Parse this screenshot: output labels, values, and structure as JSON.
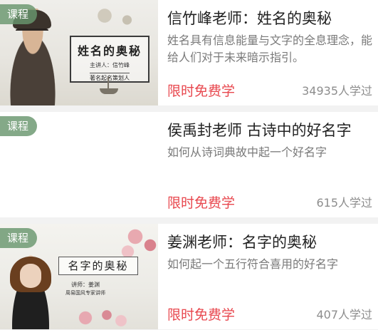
{
  "courses": [
    {
      "tag": "课程",
      "title": "信竹峰老师：姓名的奥秘",
      "description": "姓名具有信息能量与文字的全息理念，能给人们对于未来暗示指引。",
      "promo": "限时免费学",
      "learners": "34935人学过",
      "thumbnail": {
        "board_title": "姓名的奥秘",
        "board_sub": "主讲人：信竹峰",
        "board_sub2": "著名起名策划人"
      }
    },
    {
      "tag": "课程",
      "title": "侯禹封老师 古诗中的好名字",
      "description": "如何从诗词典故中起一个好名字",
      "promo": "限时免费学",
      "learners": "615人学过",
      "thumbnail": {}
    },
    {
      "tag": "课程",
      "title": "姜渊老师：名字的奥秘",
      "description": "如何起一个五行符合喜用的好名字",
      "promo": "限时免费学",
      "learners": "407人学过",
      "thumbnail": {
        "board_title": "名字的奥秘",
        "board_sub": "讲师：姜渊",
        "board_sub2": "周易国风专家讲师"
      }
    }
  ],
  "colors": {
    "promo": "#e8474e",
    "tag_bg": "#69966e",
    "background": "#f2f2f2"
  }
}
